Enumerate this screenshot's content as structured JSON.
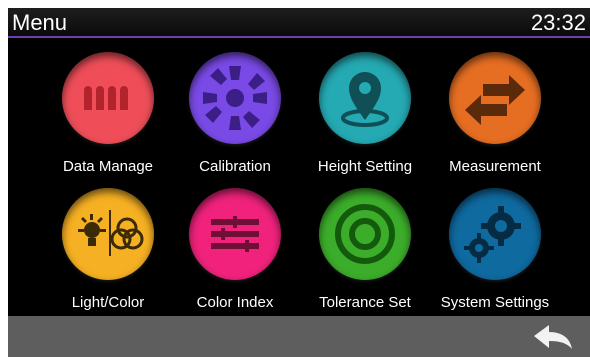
{
  "header": {
    "title": "Menu",
    "time": "23:32",
    "accent": "#6d3fb4"
  },
  "menu": {
    "items": [
      {
        "label": "Data Manage",
        "icon": "data-manage-icon",
        "color": "#ef4e59"
      },
      {
        "label": "Calibration",
        "icon": "calibration-icon",
        "color": "#7a4ae6"
      },
      {
        "label": "Height Setting",
        "icon": "location-pin-icon",
        "color": "#25a9b2"
      },
      {
        "label": "Measurement",
        "icon": "swap-arrows-icon",
        "color": "#e66e22"
      },
      {
        "label": "Light/Color",
        "icon": "light-color-icon",
        "color": "#f6b023"
      },
      {
        "label": "Color Index",
        "icon": "color-index-icon",
        "color": "#f0227c"
      },
      {
        "label": "Tolerance Set",
        "icon": "target-rings-icon",
        "color": "#3cad2a"
      },
      {
        "label": "System Settings",
        "icon": "gears-icon",
        "color": "#0f6aa0"
      }
    ]
  },
  "footer": {
    "back_icon": "back-arrow-icon",
    "background": "#5e5e5e"
  }
}
